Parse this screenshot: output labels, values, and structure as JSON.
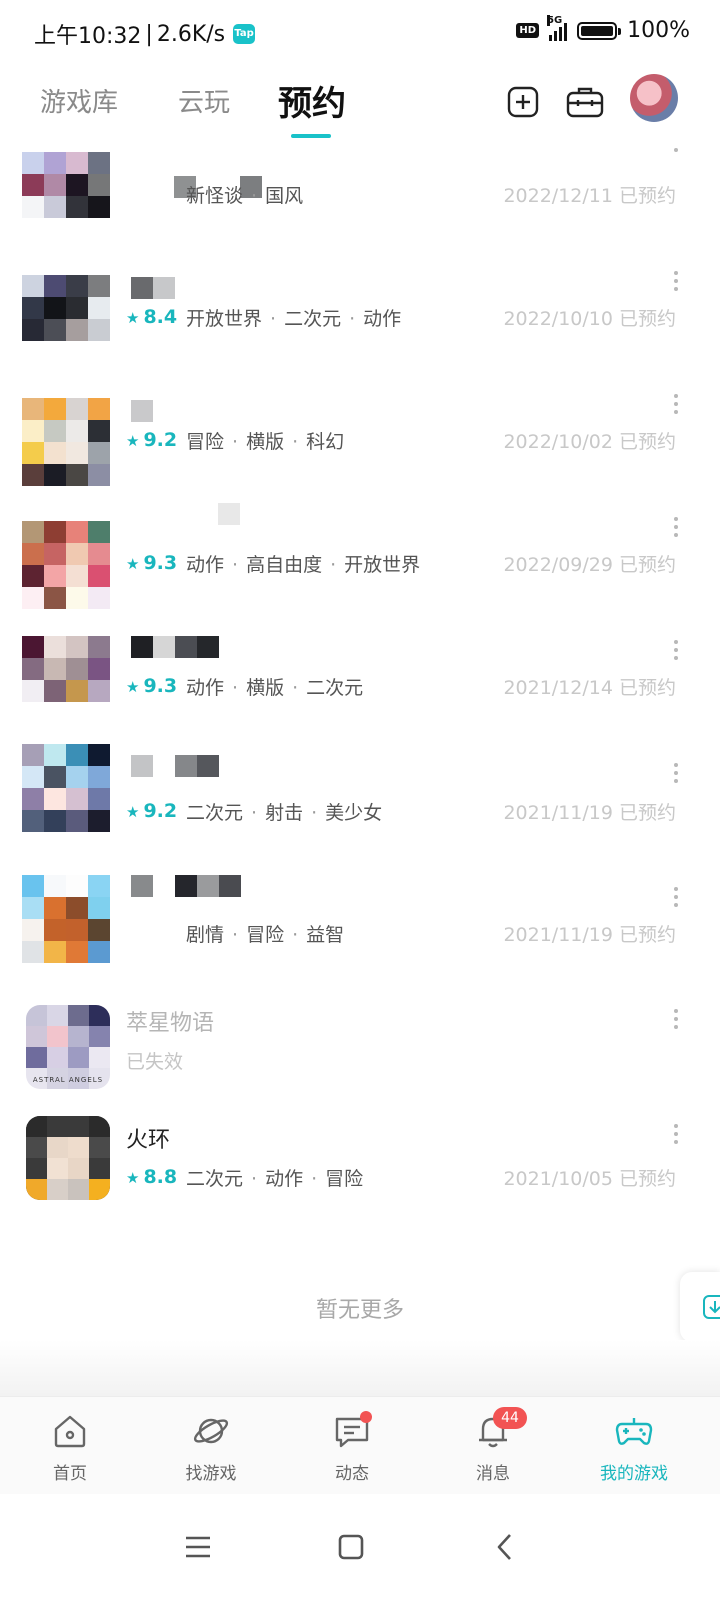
{
  "status_bar": {
    "time": "上午10:32",
    "speed": "2.6K/s",
    "tap_badge": "Tap",
    "hd": "HD",
    "network": "5G",
    "battery": "100%"
  },
  "top_nav": {
    "tabs": [
      "游戏库",
      "云玩",
      "预约"
    ],
    "active_tab": "预约",
    "accent_color": "#19c2c9"
  },
  "games": [
    {
      "name": "",
      "rating": "",
      "tags": [
        "新怪谈",
        "国风"
      ],
      "date": "2022/12/11 已预约"
    },
    {
      "name": "",
      "rating": "8.4",
      "tags": [
        "开放世界",
        "二次元",
        "动作"
      ],
      "date": "2022/10/10 已预约"
    },
    {
      "name": "",
      "rating": "9.2",
      "tags": [
        "冒险",
        "横版",
        "科幻"
      ],
      "date": "2022/10/02 已预约"
    },
    {
      "name": "",
      "rating": "9.3",
      "tags": [
        "动作",
        "高自由度",
        "开放世界"
      ],
      "date": "2022/09/29 已预约"
    },
    {
      "name": "",
      "rating": "9.3",
      "tags": [
        "动作",
        "横版",
        "二次元"
      ],
      "date": "2021/12/14 已预约"
    },
    {
      "name": "",
      "rating": "9.2",
      "tags": [
        "二次元",
        "射击",
        "美少女"
      ],
      "date": "2021/11/19 已预约"
    },
    {
      "name": "",
      "rating": "",
      "tags": [
        "剧情",
        "冒险",
        "益智"
      ],
      "date": "2021/11/19 已预约"
    },
    {
      "name": "萃星物语",
      "status": "已失效",
      "thumb_text": "ASTRAL ANGELS"
    },
    {
      "name": "火环",
      "rating": "8.8",
      "tags": [
        "二次元",
        "动作",
        "冒险"
      ],
      "date": "2021/10/05 已预约"
    }
  ],
  "footer_text": "暂无更多",
  "bottom_nav": {
    "items": [
      "首页",
      "找游戏",
      "动态",
      "消息",
      "我的游戏"
    ],
    "active": "我的游戏",
    "message_badge": "44"
  },
  "icons": [
    "add-icon",
    "toolbox-icon",
    "home-icon",
    "planet-icon",
    "chat-icon",
    "bell-icon",
    "gamepad-icon",
    "menu-icon",
    "square-icon",
    "back-icon"
  ]
}
